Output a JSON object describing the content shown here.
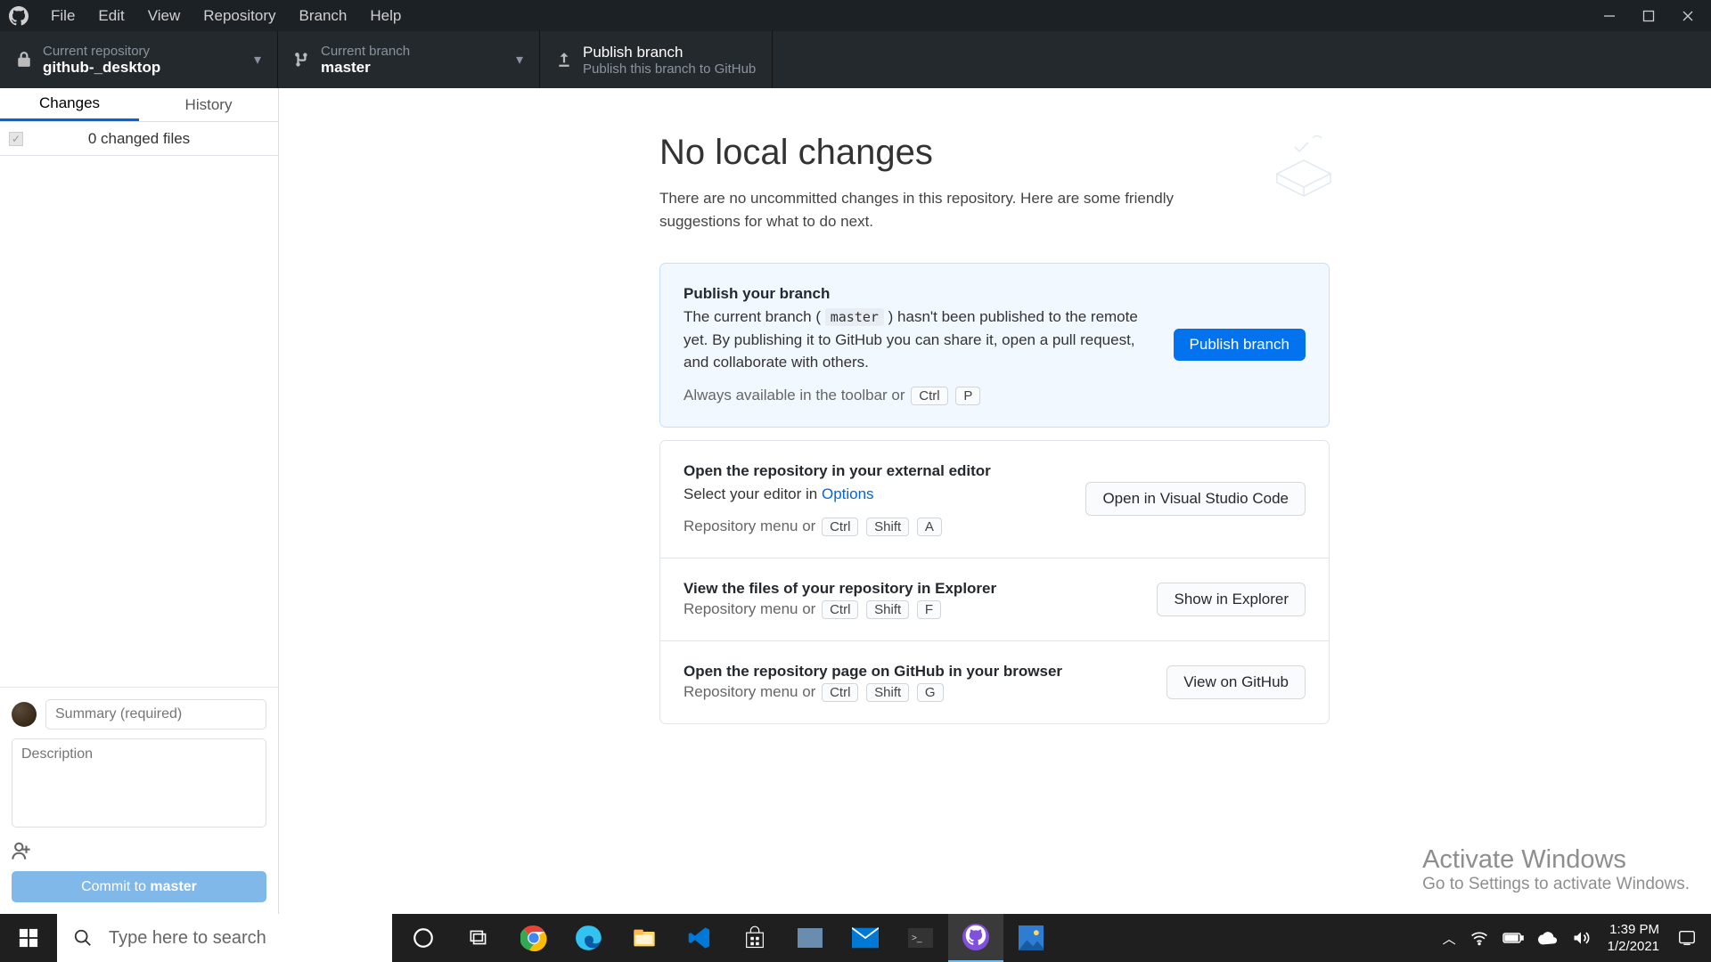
{
  "menubar": [
    "File",
    "Edit",
    "View",
    "Repository",
    "Branch",
    "Help"
  ],
  "toolbar": {
    "repo": {
      "label": "Current repository",
      "value": "github-_desktop"
    },
    "branch": {
      "label": "Current branch",
      "value": "master"
    },
    "publish": {
      "title": "Publish branch",
      "subtitle": "Publish this branch to GitHub"
    }
  },
  "sidebar": {
    "tabs": {
      "changes": "Changes",
      "history": "History"
    },
    "changed_files": "0 changed files",
    "commit": {
      "summary_placeholder": "Summary (required)",
      "description_placeholder": "Description",
      "button_prefix": "Commit to ",
      "button_branch": "master"
    }
  },
  "main": {
    "title": "No local changes",
    "subtitle": "There are no uncommitted changes in this repository. Here are some friendly suggestions for what to do next.",
    "cards": {
      "publish": {
        "title": "Publish your branch",
        "desc_pre": "The current branch ( ",
        "desc_code": "master",
        "desc_post": " ) hasn't been published to the remote yet. By publishing it to GitHub you can share it, open a pull request, and collaborate with others.",
        "hint": "Always available in the toolbar or",
        "keys": [
          "Ctrl",
          "P"
        ],
        "button": "Publish branch"
      },
      "editor": {
        "title": "Open the repository in your external editor",
        "desc": "Select your editor in ",
        "link": "Options",
        "hint": "Repository menu or",
        "keys": [
          "Ctrl",
          "Shift",
          "A"
        ],
        "button": "Open in Visual Studio Code"
      },
      "explorer": {
        "title": "View the files of your repository in Explorer",
        "hint": "Repository menu or",
        "keys": [
          "Ctrl",
          "Shift",
          "F"
        ],
        "button": "Show in Explorer"
      },
      "github": {
        "title": "Open the repository page on GitHub in your browser",
        "hint": "Repository menu or",
        "keys": [
          "Ctrl",
          "Shift",
          "G"
        ],
        "button": "View on GitHub"
      }
    }
  },
  "watermark": {
    "line1": "Activate Windows",
    "line2": "Go to Settings to activate Windows."
  },
  "taskbar": {
    "search_placeholder": "Type here to search"
  },
  "clock": {
    "time": "1:39 PM",
    "date": "1/2/2021"
  }
}
